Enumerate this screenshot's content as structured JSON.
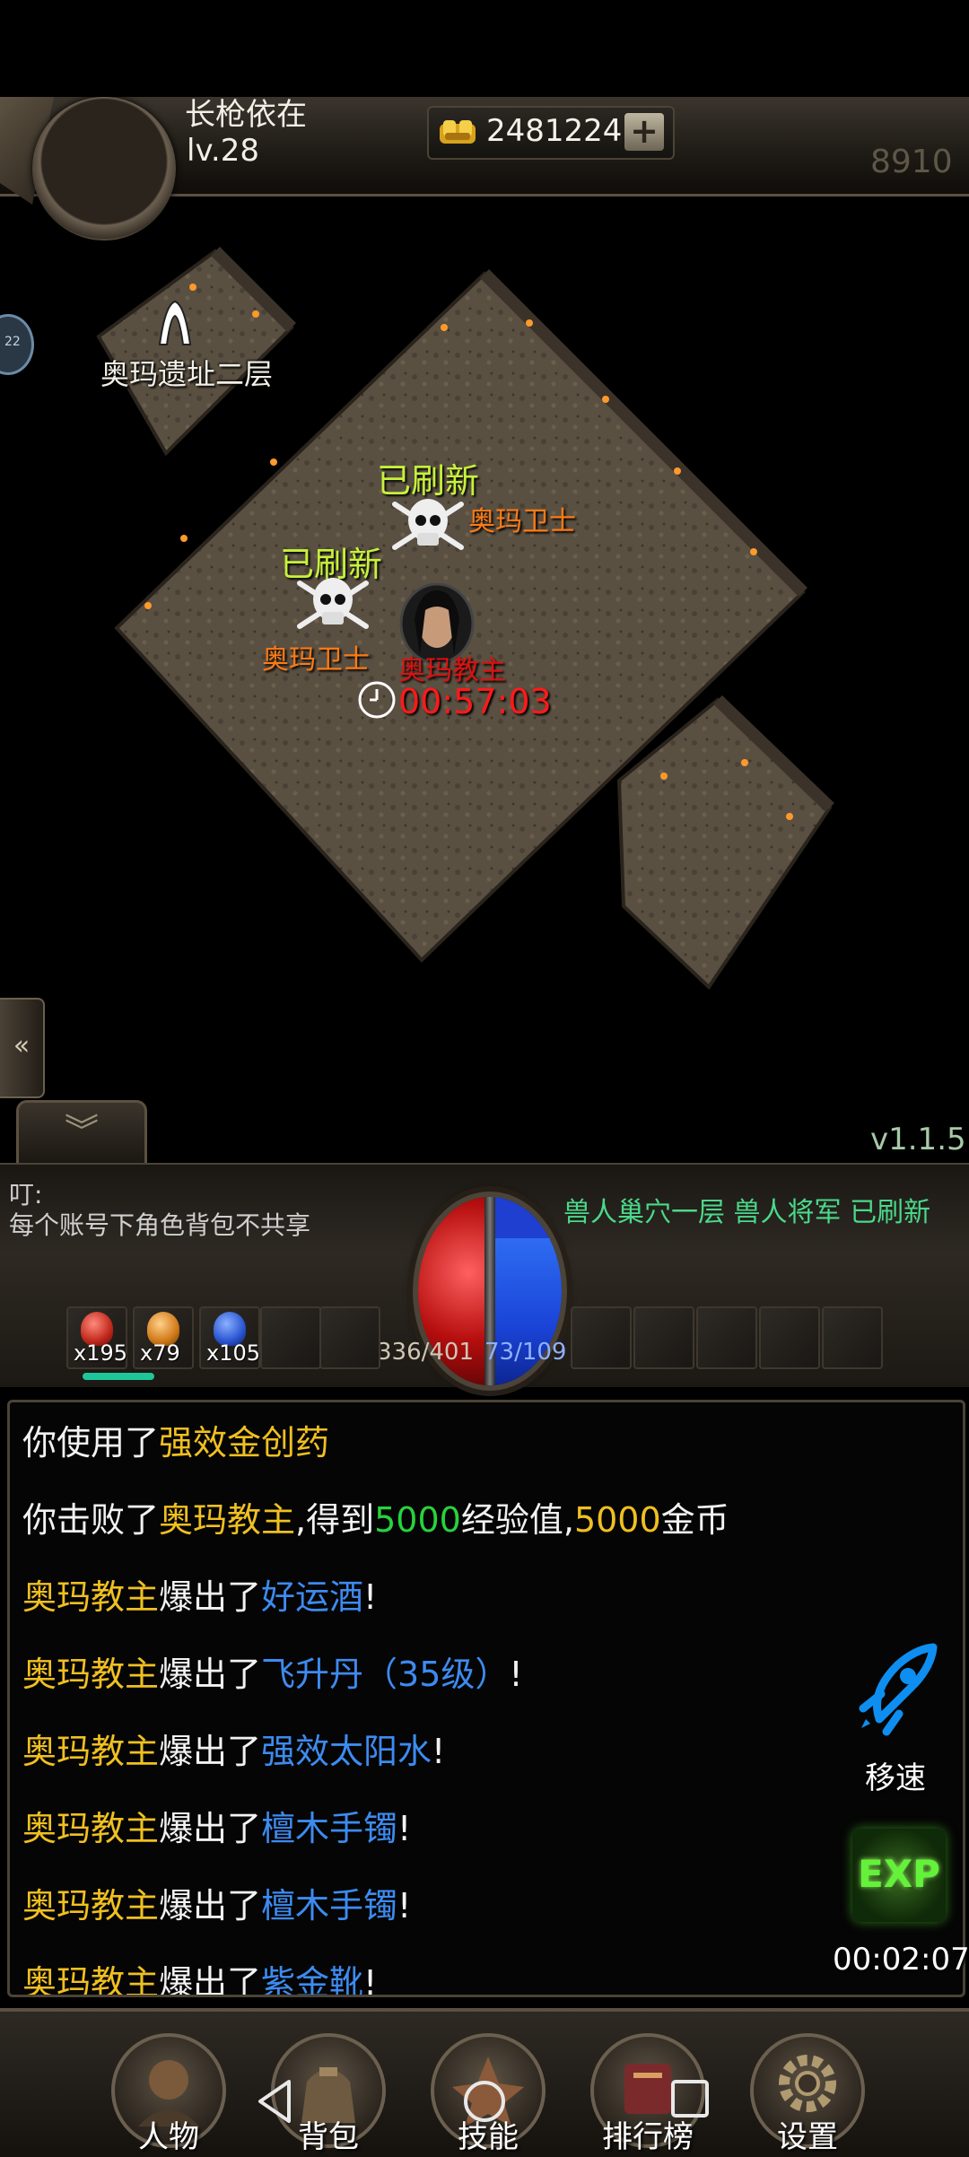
{
  "header": {
    "player_name": "长枪依在",
    "player_level": "lv.28",
    "gold": "2481224",
    "gold_add": "+",
    "power": "8910"
  },
  "map": {
    "entrance_label": "奥玛遗址二层",
    "spawns": [
      {
        "status": "已刷新",
        "monster": "奥玛卫士"
      },
      {
        "status": "已刷新",
        "monster": "奥玛卫士"
      }
    ],
    "boss_name": "奥玛教主",
    "boss_timer": "00:57:03"
  },
  "side": {
    "bubble_text": "22",
    "collapse_icon": "«",
    "chat_toggle_icon": "︾"
  },
  "version": "v1.1.5",
  "hud": {
    "ding_label": "叮:",
    "notice": "每个账号下角色背包不共享",
    "world_msg": "兽人巢穴一层 兽人将军  已刷新",
    "hp": "336/401",
    "mp": "73/109",
    "hp_fraction": 0.84,
    "mp_fraction": 0.67,
    "potions": [
      {
        "name": "red-potion-icon",
        "count": "x195",
        "color": "#c0281c"
      },
      {
        "name": "orange-potion-icon",
        "count": "x79",
        "color": "#d07a18"
      },
      {
        "name": "blue-potion-icon",
        "count": "x105",
        "color": "#2a55d0"
      }
    ]
  },
  "chat": {
    "l1": {
      "a": "你使用了",
      "b": "强效金创药"
    },
    "l2": {
      "a": "你击败了",
      "b": "奥玛教主",
      "c": ",得到",
      "d": "5000",
      "e": "经验值,",
      "f": "5000",
      "g": "金币"
    },
    "l3": {
      "a": "奥玛教主",
      "b": "爆出了",
      "c": "好运酒",
      "d": "!"
    },
    "l4": {
      "a": "奥玛教主",
      "b": "爆出了",
      "c": "飞升丹（35级）",
      "d": "!"
    },
    "l5": {
      "a": "奥玛教主",
      "b": "爆出了",
      "c": "强效太阳水",
      "d": "!"
    },
    "l6": {
      "a": "奥玛教主",
      "b": "爆出了",
      "c": "檀木手镯",
      "d": "!"
    },
    "l7": {
      "a": "奥玛教主",
      "b": "爆出了",
      "c": "檀木手镯",
      "d": "!"
    },
    "l8": {
      "a": "奥玛教主",
      "b": "爆出了",
      "c": "紫金靴",
      "d": "!"
    }
  },
  "buttons": {
    "speed": "移速",
    "exp": "EXP",
    "exp_timer": "00:02:07"
  },
  "nav": {
    "character": "人物",
    "bag": "背包",
    "skills": "技能",
    "ranking": "排行榜",
    "settings": "设置"
  },
  "colors": {
    "yellow_text": "#f0c020",
    "green_text": "#28d23c",
    "blue_text": "#3d8bf0",
    "refresh_green": "#c6f23a",
    "monster_orange": "#ff7a14",
    "boss_red": "#e01010"
  }
}
